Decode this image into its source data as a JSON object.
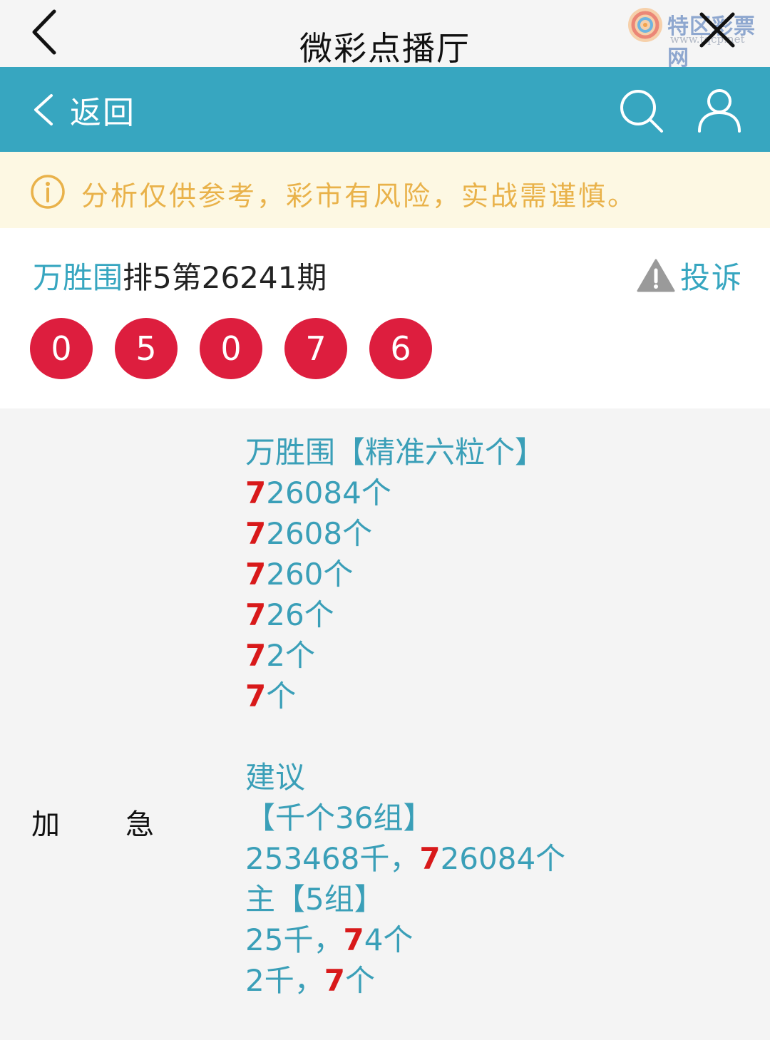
{
  "header": {
    "title": "微彩点播厅",
    "watermark_text": "特区彩票网",
    "watermark_url": "www.tqcp.net"
  },
  "nav": {
    "back_label": "返回"
  },
  "notice": {
    "text": "分析仅供参考，彩市有风险，实战需谨慎。"
  },
  "card": {
    "author": "万胜围",
    "issue": "排5第26241期",
    "report_label": "投诉",
    "balls": [
      "0",
      "5",
      "0",
      "7",
      "6"
    ]
  },
  "side": {
    "left": "加",
    "right": "急"
  },
  "content": {
    "heading": "万胜围【精准六粒个】",
    "lines": [
      {
        "red": "7",
        "rest": "26084个"
      },
      {
        "red": "7",
        "rest": "2608个"
      },
      {
        "red": "7",
        "rest": "260个"
      },
      {
        "red": "7",
        "rest": "26个"
      },
      {
        "red": "7",
        "rest": "2个"
      },
      {
        "red": "7",
        "rest": "个"
      }
    ],
    "suggest": "建议",
    "group36": "【千个36组】",
    "line36": {
      "pre": "253468千，",
      "red": "7",
      "rest": "26084个"
    },
    "main5": "主【5组】",
    "line5a": {
      "pre": "25千，",
      "red": "7",
      "rest": "4个"
    },
    "line5b": {
      "pre": "2千，",
      "red": "7",
      "rest": "个"
    }
  },
  "colors": {
    "accent": "#37a6c0",
    "ball": "#dd1e3e",
    "highlight": "#d8191a",
    "notice_text": "#e9b24a",
    "notice_bg": "#fdf8e3"
  }
}
